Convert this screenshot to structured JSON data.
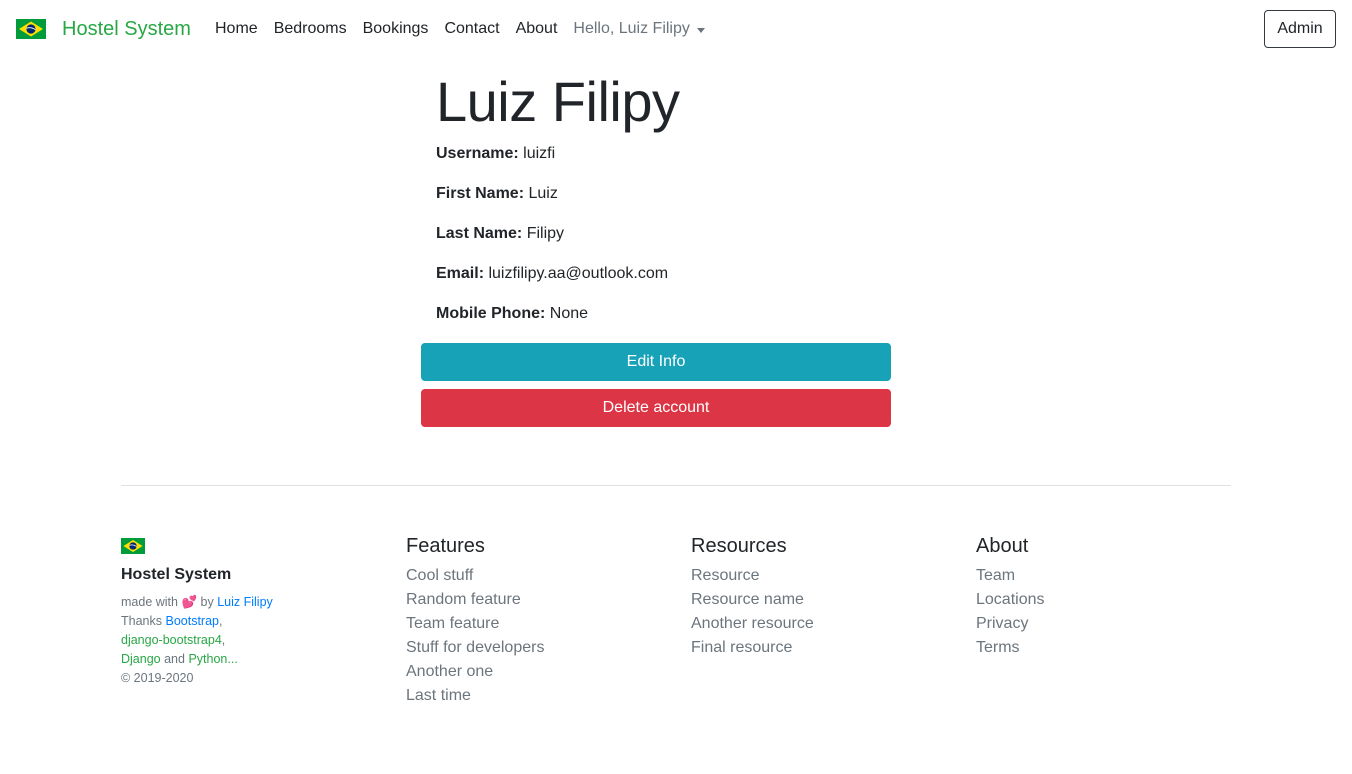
{
  "navbar": {
    "brand": "Hostel System",
    "links": [
      "Home",
      "Bedrooms",
      "Bookings",
      "Contact",
      "About"
    ],
    "user_menu": "Hello, Luiz Filipy",
    "admin_button": "Admin"
  },
  "profile": {
    "name": "Luiz Filipy",
    "fields": [
      {
        "label": "Username:",
        "value": "luizfi"
      },
      {
        "label": "First Name:",
        "value": "Luiz"
      },
      {
        "label": "Last Name:",
        "value": "Filipy"
      },
      {
        "label": "Email:",
        "value": "luizfilipy.aa@outlook.com"
      },
      {
        "label": "Mobile Phone:",
        "value": "None"
      }
    ],
    "edit_button": "Edit Info",
    "delete_button": "Delete account"
  },
  "footer": {
    "brand": "Hostel System",
    "made_with_prefix": "made with",
    "heart": "💕",
    "by": "by",
    "author": "Luiz Filipy",
    "thanks": "Thanks",
    "bootstrap": "Bootstrap",
    "django_bootstrap": "django-bootstrap4",
    "django": "Django",
    "and": "and",
    "python": "Python...",
    "copyright": "© 2019-2020",
    "columns": [
      {
        "title": "Features",
        "links": [
          "Cool stuff",
          "Random feature",
          "Team feature",
          "Stuff for developers",
          "Another one",
          "Last time"
        ]
      },
      {
        "title": "Resources",
        "links": [
          "Resource",
          "Resource name",
          "Another resource",
          "Final resource"
        ]
      },
      {
        "title": "About",
        "links": [
          "Team",
          "Locations",
          "Privacy",
          "Terms"
        ]
      }
    ]
  },
  "colors": {
    "brand_green": "#28a745",
    "info": "#17a2b8",
    "danger": "#dc3545",
    "link_blue": "#007bff"
  }
}
